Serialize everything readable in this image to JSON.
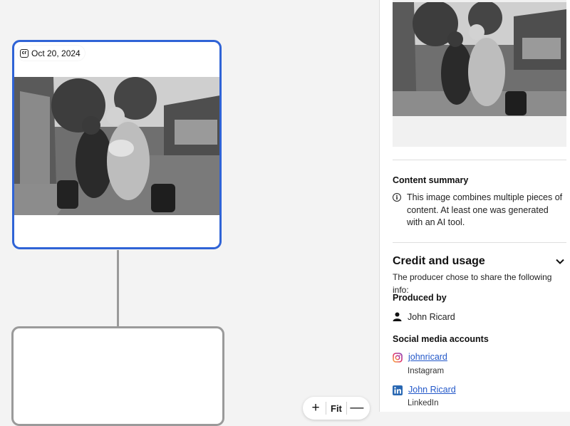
{
  "canvas": {
    "selected_node": {
      "date": "Oct 20, 2024",
      "cr_badge": "cr"
    },
    "zoom": {
      "plus": "+",
      "fit_label": "Fit",
      "minus": "—"
    }
  },
  "panel": {
    "content_summary": {
      "title": "Content summary",
      "text": "This image combines multiple pieces of content. At least one was generated with an AI tool."
    },
    "credit": {
      "title": "Credit and usage",
      "subtitle": "The producer chose to share the following info:",
      "produced_by_label": "Produced by",
      "producer": "John Ricard",
      "social_label": "Social media accounts",
      "accounts": [
        {
          "handle": "johnricard",
          "platform": "Instagram"
        },
        {
          "handle": "John Ricard",
          "platform": "LinkedIn"
        }
      ]
    }
  },
  "colors": {
    "accent": "#2f63d6",
    "link": "#2358c9"
  }
}
